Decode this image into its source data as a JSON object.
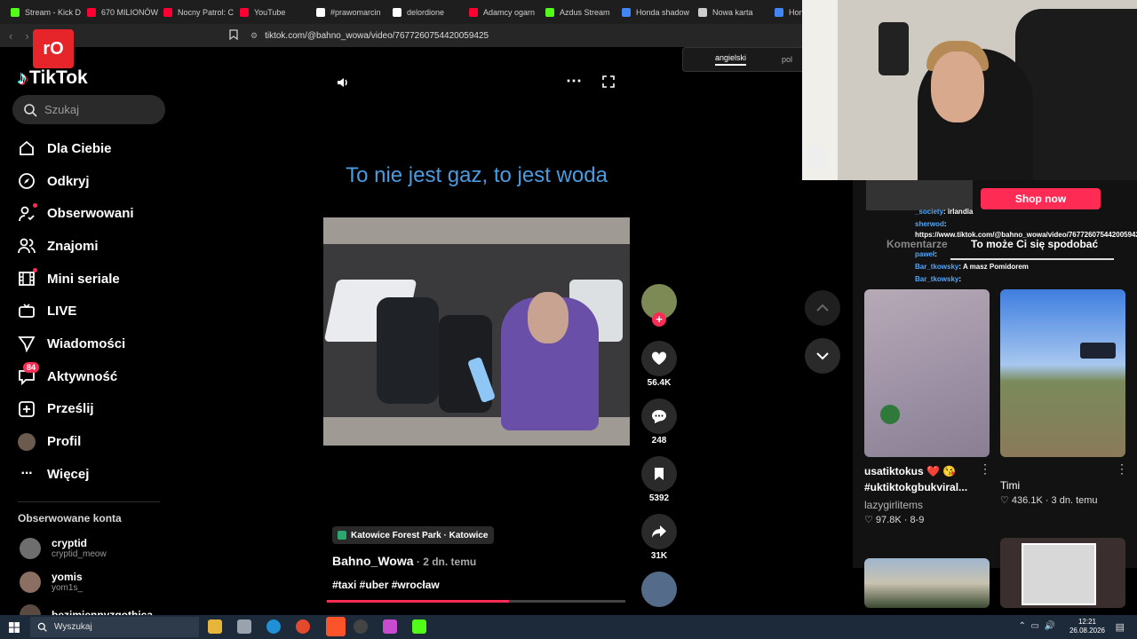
{
  "browser": {
    "tabs": [
      {
        "label": "Stream - Kick D",
        "color": "#53fc18"
      },
      {
        "label": "670 MILIONÓW",
        "color": "#ff0033"
      },
      {
        "label": "Nocny Patrol: C",
        "color": "#ff0033"
      },
      {
        "label": "YouTube",
        "color": "#ff0033"
      },
      {
        "label": "#prawomarcin",
        "color": "#ffffff"
      },
      {
        "label": "delordione",
        "color": "#ffffff"
      },
      {
        "label": "Adamcy ogarn",
        "color": "#ff0033"
      },
      {
        "label": "Azdus Stream",
        "color": "#53fc18"
      },
      {
        "label": "Honda shadow",
        "color": "#4285f4"
      },
      {
        "label": "Nowa karta",
        "color": "#cccccc"
      },
      {
        "label": "Hond",
        "color": "#4285f4"
      }
    ],
    "url": "tiktok.com/@bahno_wowa/video/7677260754420059425"
  },
  "sidebar": {
    "logo": "TikTok",
    "stamp": "rO",
    "search_placeholder": "Szukaj",
    "items": [
      {
        "label": "Dla Ciebie",
        "icon": "home-icon"
      },
      {
        "label": "Odkryj",
        "icon": "compass-icon"
      },
      {
        "label": "Obserwowani",
        "icon": "following-icon"
      },
      {
        "label": "Znajomi",
        "icon": "friends-icon"
      },
      {
        "label": "Mini seriale",
        "icon": "film-icon"
      },
      {
        "label": "LIVE",
        "icon": "live-icon"
      },
      {
        "label": "Wiadomości",
        "icon": "send-icon"
      },
      {
        "label": "Aktywność",
        "icon": "inbox-icon",
        "badge": "84"
      },
      {
        "label": "Prześlij",
        "icon": "upload-icon"
      },
      {
        "label": "Profil",
        "icon": "profile-avatar"
      },
      {
        "label": "Więcej",
        "icon": "more-icon"
      }
    ],
    "followed_header": "Obserwowane konta",
    "accounts": [
      {
        "name": "cryptid",
        "handle": "cryptid_meow"
      },
      {
        "name": "yomis",
        "handle": "yom1s_"
      },
      {
        "name": "bezimiennyzgothica",
        "handle": ""
      }
    ]
  },
  "video": {
    "caption": "To nie jest gaz, to jest woda",
    "location": "Katowice Forest Park · Katowice",
    "author": "Bahno_Wowa",
    "time": " · 2 dn. temu",
    "tags": "#taxi #uber #wrocław",
    "progress": 0.61,
    "likes": "56.4K",
    "comments": "248",
    "saves": "5392",
    "shares": "31K"
  },
  "language": {
    "active": "angielski",
    "other": "pol"
  },
  "panel": {
    "shop_label": "Shop now",
    "comments_tab": "Komentarze",
    "suggest_tab": "To może Ci się spodobać",
    "chat": [
      {
        "user": "_society",
        "text": " irlandia",
        "color": "#4ea6ff"
      },
      {
        "user": "sherwod",
        "text": " https://www.tiktok.com/@bahno_wowa/video/7677260754420059425",
        "color": "#4ea6ff"
      },
      {
        "user": "paweł",
        "text": "",
        "color": "#4ea6ff"
      },
      {
        "user": "Bar_tkowsky",
        "text": " A masz Pomidorem",
        "color": "#4ea6ff"
      },
      {
        "user": "Bar_tkowsky",
        "text": "",
        "color": "#4ea6ff"
      }
    ],
    "cards": [
      {
        "title": "usatiktokus ❤️ 😘 #uktiktokgbukviral...",
        "author": "lazygirlitems",
        "stats": "♡ 97.8K · 8-9"
      },
      {
        "title": "Timi",
        "author": "",
        "stats": "♡ 436.1K · 3 dn. temu"
      }
    ]
  },
  "taskbar": {
    "search": "Wyszukaj",
    "time": "12:21",
    "date": "26.08.2026"
  }
}
